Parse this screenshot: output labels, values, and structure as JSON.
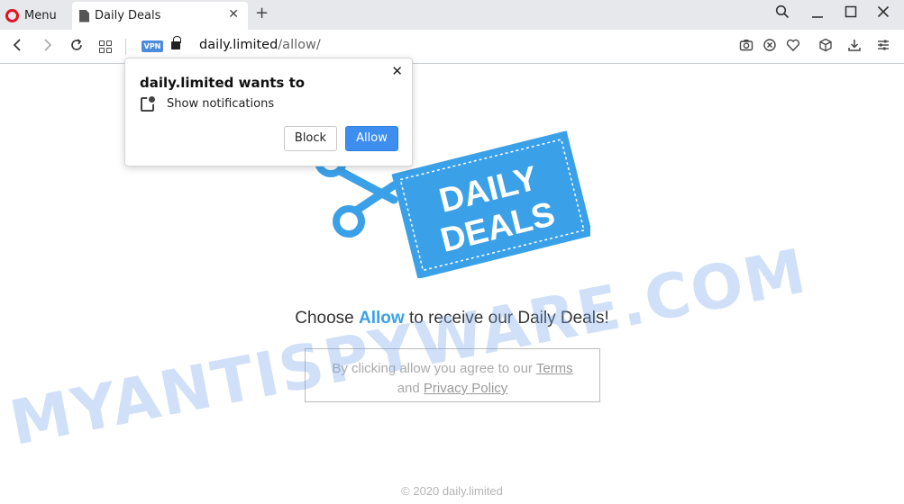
{
  "browser": {
    "menu_label": "Menu",
    "tab_title": "Daily Deals",
    "tab_close_glyph": "✕",
    "new_tab_glyph": "+",
    "vpn_badge": "VPN",
    "url_domain": "daily.limited",
    "url_path": "/allow/"
  },
  "popup": {
    "title": "daily.limited wants to",
    "permission": "Show notifications",
    "block_label": "Block",
    "allow_label": "Allow",
    "close_glyph": "✕"
  },
  "page": {
    "logo_line1": "DAILY",
    "logo_line2": "DEALS",
    "headline_prefix": "Choose ",
    "headline_emphasis": "Allow",
    "headline_suffix": " to receive our Daily Deals!",
    "terms_prefix": "By clicking allow you agree to our ",
    "terms_link": "Terms",
    "terms_and": "and ",
    "privacy_link": "Privacy Policy",
    "footer": "© 2020 daily.limited"
  },
  "watermark": "MYANTISPYWARE.COM",
  "colors": {
    "accent": "#3aa0e8",
    "allow_button": "#3d8eef",
    "logo_blue": "#3aa0e8",
    "opera_red": "#e2141f"
  }
}
